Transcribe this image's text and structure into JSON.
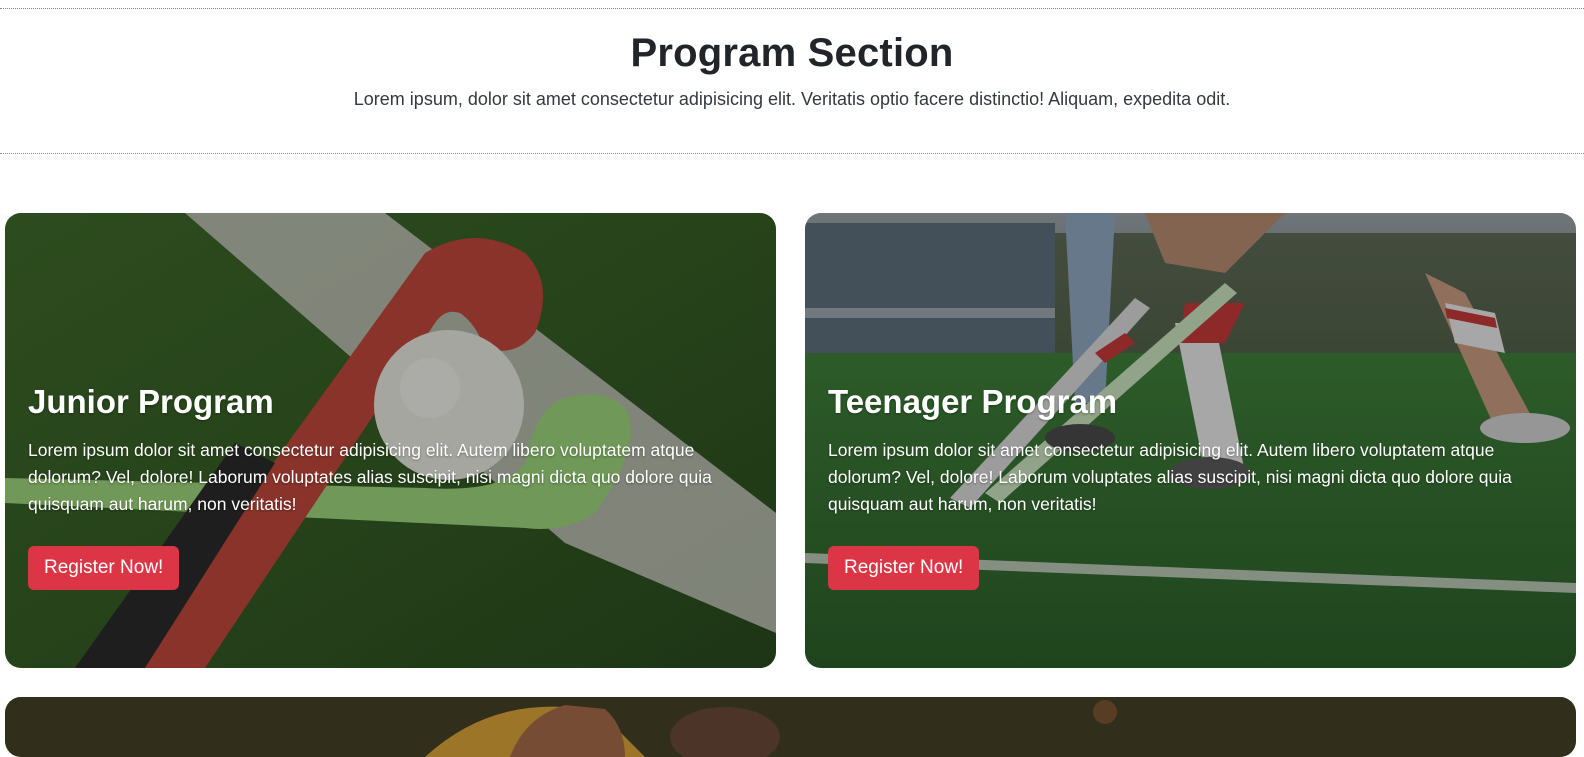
{
  "section": {
    "title": "Program Section",
    "subtitle": "Lorem ipsum, dolor sit amet consectetur adipisicing elit. Veritatis optio facere distinctio! Aliquam, expedita odit."
  },
  "cards": [
    {
      "title": "Junior Program",
      "text": "Lorem ipsum dolor sit amet consectetur adipisicing elit. Autem libero voluptatem atque dolorum? Vel, dolore! Laborum voluptates alias suscipit, nisi magni dicta quo dolore quia quisquam aut harum, non veritatis!",
      "button_label": "Register Now!",
      "image": "hockey-stick-and-ball-image"
    },
    {
      "title": "Teenager Program",
      "text": "Lorem ipsum dolor sit amet consectetur adipisicing elit. Autem libero voluptatem atque dolorum? Vel, dolore! Laborum voluptates alias suscipit, nisi magni dicta quo dolore quia quisquam aut harum, non veritatis!",
      "button_label": "Register Now!",
      "image": "field-hockey-players-image"
    },
    {
      "image": "hockey-players-partial-image"
    }
  ],
  "colors": {
    "accent": "#dc3545",
    "heading": "#212529",
    "card_text": "#ffffff"
  }
}
